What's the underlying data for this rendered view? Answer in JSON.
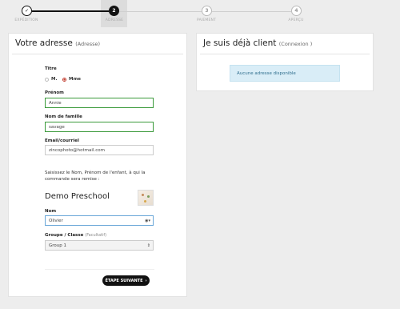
{
  "stepper": {
    "steps": [
      {
        "number": "✓",
        "label": "EXPÉDITION"
      },
      {
        "number": "2",
        "label": "ADRESSE"
      },
      {
        "number": "3",
        "label": "PAIEMENT"
      },
      {
        "number": "4",
        "label": "APERÇU"
      }
    ]
  },
  "address": {
    "title": "Votre adresse",
    "subtitle": "(Adresse)",
    "titre_label": "Titre",
    "radio_m": "M.",
    "radio_mme": "Mme",
    "prenom_label": "Prénom",
    "prenom_value": "Annie",
    "nom_label": "Nom de famille",
    "nom_value": "savage",
    "email_label": "Email/courriel",
    "email_value": "zincophoto@hotmail.com",
    "info_text": "Saisissez le Nom, Prénom de l'enfant, à qui la commande sera remise :",
    "school_name": "Demo Preschool",
    "child_label": "Nom",
    "child_value": "Olivier",
    "group_label": "Groupe / Classe",
    "group_optional": "(Facultatif)",
    "group_value": "Group 1",
    "next_button": "ÉTAPE SUIVANTE"
  },
  "client": {
    "title": "Je suis déjà client",
    "subtitle": "(Connexion )",
    "alert": "Aucune adresse disponible"
  }
}
